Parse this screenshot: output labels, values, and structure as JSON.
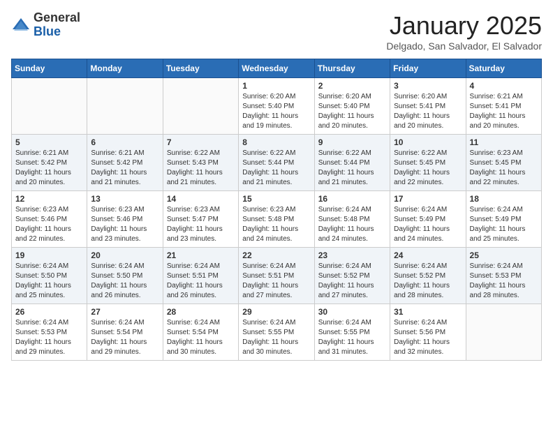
{
  "header": {
    "logo_general": "General",
    "logo_blue": "Blue",
    "month_title": "January 2025",
    "location": "Delgado, San Salvador, El Salvador"
  },
  "weekdays": [
    "Sunday",
    "Monday",
    "Tuesday",
    "Wednesday",
    "Thursday",
    "Friday",
    "Saturday"
  ],
  "weeks": [
    [
      {
        "day": "",
        "info": ""
      },
      {
        "day": "",
        "info": ""
      },
      {
        "day": "",
        "info": ""
      },
      {
        "day": "1",
        "info": "Sunrise: 6:20 AM\nSunset: 5:40 PM\nDaylight: 11 hours and 19 minutes."
      },
      {
        "day": "2",
        "info": "Sunrise: 6:20 AM\nSunset: 5:40 PM\nDaylight: 11 hours and 20 minutes."
      },
      {
        "day": "3",
        "info": "Sunrise: 6:20 AM\nSunset: 5:41 PM\nDaylight: 11 hours and 20 minutes."
      },
      {
        "day": "4",
        "info": "Sunrise: 6:21 AM\nSunset: 5:41 PM\nDaylight: 11 hours and 20 minutes."
      }
    ],
    [
      {
        "day": "5",
        "info": "Sunrise: 6:21 AM\nSunset: 5:42 PM\nDaylight: 11 hours and 20 minutes."
      },
      {
        "day": "6",
        "info": "Sunrise: 6:21 AM\nSunset: 5:42 PM\nDaylight: 11 hours and 21 minutes."
      },
      {
        "day": "7",
        "info": "Sunrise: 6:22 AM\nSunset: 5:43 PM\nDaylight: 11 hours and 21 minutes."
      },
      {
        "day": "8",
        "info": "Sunrise: 6:22 AM\nSunset: 5:44 PM\nDaylight: 11 hours and 21 minutes."
      },
      {
        "day": "9",
        "info": "Sunrise: 6:22 AM\nSunset: 5:44 PM\nDaylight: 11 hours and 21 minutes."
      },
      {
        "day": "10",
        "info": "Sunrise: 6:22 AM\nSunset: 5:45 PM\nDaylight: 11 hours and 22 minutes."
      },
      {
        "day": "11",
        "info": "Sunrise: 6:23 AM\nSunset: 5:45 PM\nDaylight: 11 hours and 22 minutes."
      }
    ],
    [
      {
        "day": "12",
        "info": "Sunrise: 6:23 AM\nSunset: 5:46 PM\nDaylight: 11 hours and 22 minutes."
      },
      {
        "day": "13",
        "info": "Sunrise: 6:23 AM\nSunset: 5:46 PM\nDaylight: 11 hours and 23 minutes."
      },
      {
        "day": "14",
        "info": "Sunrise: 6:23 AM\nSunset: 5:47 PM\nDaylight: 11 hours and 23 minutes."
      },
      {
        "day": "15",
        "info": "Sunrise: 6:23 AM\nSunset: 5:48 PM\nDaylight: 11 hours and 24 minutes."
      },
      {
        "day": "16",
        "info": "Sunrise: 6:24 AM\nSunset: 5:48 PM\nDaylight: 11 hours and 24 minutes."
      },
      {
        "day": "17",
        "info": "Sunrise: 6:24 AM\nSunset: 5:49 PM\nDaylight: 11 hours and 24 minutes."
      },
      {
        "day": "18",
        "info": "Sunrise: 6:24 AM\nSunset: 5:49 PM\nDaylight: 11 hours and 25 minutes."
      }
    ],
    [
      {
        "day": "19",
        "info": "Sunrise: 6:24 AM\nSunset: 5:50 PM\nDaylight: 11 hours and 25 minutes."
      },
      {
        "day": "20",
        "info": "Sunrise: 6:24 AM\nSunset: 5:50 PM\nDaylight: 11 hours and 26 minutes."
      },
      {
        "day": "21",
        "info": "Sunrise: 6:24 AM\nSunset: 5:51 PM\nDaylight: 11 hours and 26 minutes."
      },
      {
        "day": "22",
        "info": "Sunrise: 6:24 AM\nSunset: 5:51 PM\nDaylight: 11 hours and 27 minutes."
      },
      {
        "day": "23",
        "info": "Sunrise: 6:24 AM\nSunset: 5:52 PM\nDaylight: 11 hours and 27 minutes."
      },
      {
        "day": "24",
        "info": "Sunrise: 6:24 AM\nSunset: 5:52 PM\nDaylight: 11 hours and 28 minutes."
      },
      {
        "day": "25",
        "info": "Sunrise: 6:24 AM\nSunset: 5:53 PM\nDaylight: 11 hours and 28 minutes."
      }
    ],
    [
      {
        "day": "26",
        "info": "Sunrise: 6:24 AM\nSunset: 5:53 PM\nDaylight: 11 hours and 29 minutes."
      },
      {
        "day": "27",
        "info": "Sunrise: 6:24 AM\nSunset: 5:54 PM\nDaylight: 11 hours and 29 minutes."
      },
      {
        "day": "28",
        "info": "Sunrise: 6:24 AM\nSunset: 5:54 PM\nDaylight: 11 hours and 30 minutes."
      },
      {
        "day": "29",
        "info": "Sunrise: 6:24 AM\nSunset: 5:55 PM\nDaylight: 11 hours and 30 minutes."
      },
      {
        "day": "30",
        "info": "Sunrise: 6:24 AM\nSunset: 5:55 PM\nDaylight: 11 hours and 31 minutes."
      },
      {
        "day": "31",
        "info": "Sunrise: 6:24 AM\nSunset: 5:56 PM\nDaylight: 11 hours and 32 minutes."
      },
      {
        "day": "",
        "info": ""
      }
    ]
  ]
}
